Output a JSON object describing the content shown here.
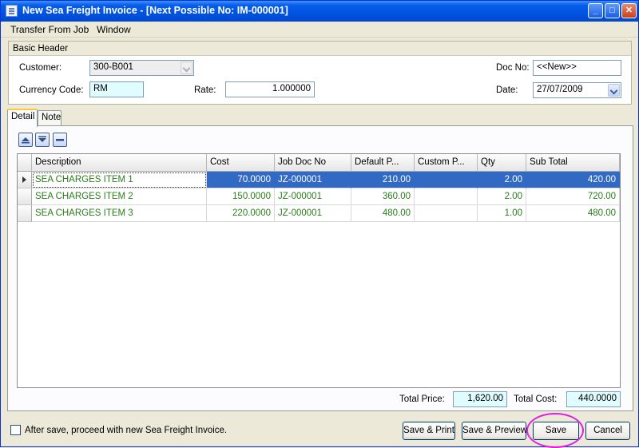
{
  "window": {
    "title": "New Sea Freight Invoice  - [Next Possible No: IM-000001]",
    "controls": {
      "minimize": "_",
      "maximize": "□",
      "close": "✕"
    }
  },
  "menu": {
    "items": [
      "Transfer From Job",
      "Window"
    ]
  },
  "basic_header": {
    "title": "Basic Header",
    "customer_label": "Customer:",
    "customer_value": "300-B001",
    "currency_label": "Currency Code:",
    "currency_value": "RM",
    "rate_label": "Rate:",
    "rate_value": "1.000000",
    "doc_no_label": "Doc No:",
    "doc_no_value": "<<New>>",
    "date_label": "Date:",
    "date_value": "27/07/2009"
  },
  "tabs": [
    {
      "label": "Detail",
      "active": true
    },
    {
      "label": "Note",
      "active": false
    }
  ],
  "toolbar": {
    "icons": [
      "move-up-icon",
      "move-down-icon",
      "delete-row-icon"
    ]
  },
  "grid": {
    "columns": [
      "Description",
      "Cost",
      "Job Doc No",
      "Default P...",
      "Custom P...",
      "Qty",
      "Sub Total"
    ],
    "rows": [
      {
        "description": "SEA CHARGES ITEM 1",
        "cost": "70.0000",
        "job_doc_no": "JZ-000001",
        "default_price": "210.00",
        "custom_price": "",
        "qty": "2.00",
        "sub_total": "420.00",
        "selected": true
      },
      {
        "description": "SEA CHARGES ITEM 2",
        "cost": "150.0000",
        "job_doc_no": "JZ-000001",
        "default_price": "360.00",
        "custom_price": "",
        "qty": "2.00",
        "sub_total": "720.00",
        "selected": false
      },
      {
        "description": "SEA CHARGES ITEM 3",
        "cost": "220.0000",
        "job_doc_no": "JZ-000001",
        "default_price": "480.00",
        "custom_price": "",
        "qty": "1.00",
        "sub_total": "480.00",
        "selected": false
      }
    ],
    "text_color": "#2a7d1a",
    "selection_color": "#316ac5"
  },
  "totals": {
    "total_price_label": "Total Price:",
    "total_price_value": "1,620.00",
    "total_cost_label": "Total Cost:",
    "total_cost_value": "440.0000"
  },
  "footer": {
    "checkbox_label": "After save, proceed with new Sea Freight Invoice.",
    "checkbox_checked": false,
    "save_print_label": "Save & Print",
    "save_preview_label": "Save & Preview",
    "save_label": "Save",
    "cancel_label": "Cancel"
  },
  "colors": {
    "title_bar": "#0054e3",
    "highlight_ring": "#e020e0"
  }
}
